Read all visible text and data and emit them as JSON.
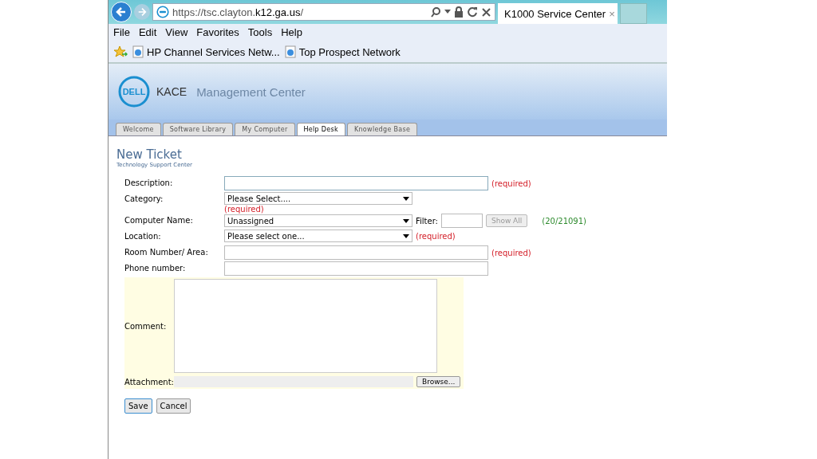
{
  "browser": {
    "url_prefix": "https://tsc.clayton.",
    "url_domain": "k12.ga.us",
    "url_suffix": "/",
    "tab_title": "K1000 Service Center",
    "tab_close": "×"
  },
  "menu": [
    "File",
    "Edit",
    "View",
    "Favorites",
    "Tools",
    "Help"
  ],
  "favorites": [
    "HP Channel Services Netw...",
    "Top Prospect Network"
  ],
  "header": {
    "logo": "DELL",
    "product": "KACE",
    "title": "Management Center"
  },
  "tabs": [
    {
      "label": "Welcome",
      "selected": false
    },
    {
      "label": "Software Library",
      "selected": false
    },
    {
      "label": "My Computer",
      "selected": false
    },
    {
      "label": "Help Desk",
      "selected": true
    },
    {
      "label": "Knowledge Base",
      "selected": false
    }
  ],
  "page": {
    "title": "New Ticket",
    "subtitle": "Technology Support Center"
  },
  "fields": [
    {
      "kind": "text",
      "label": "Description:",
      "note": "(required)",
      "note_below": false
    },
    {
      "kind": "select",
      "label": "Category:",
      "value": "Please Select....",
      "note": "(required)",
      "note_below": true
    },
    {
      "kind": "select_filter",
      "label": "Computer Name:",
      "value": "Unassigned",
      "filter_label": "Filter:",
      "button": "Show All",
      "button_disabled": true,
      "count": "(20/21091)"
    },
    {
      "kind": "select",
      "label": "Location:",
      "value": "Please select one...",
      "note": "(required)",
      "note_below": false
    },
    {
      "kind": "text",
      "label": "Room Number/ Area:",
      "note": "(required)",
      "note_below": false
    },
    {
      "kind": "text",
      "label": "Phone number:"
    }
  ],
  "comment": {
    "label": "Comment:"
  },
  "attachment": {
    "label": "Attachment:",
    "button": "Browse..."
  },
  "buttons": [
    {
      "label": "Save",
      "selected": true
    },
    {
      "label": "Cancel",
      "selected": false
    }
  ]
}
